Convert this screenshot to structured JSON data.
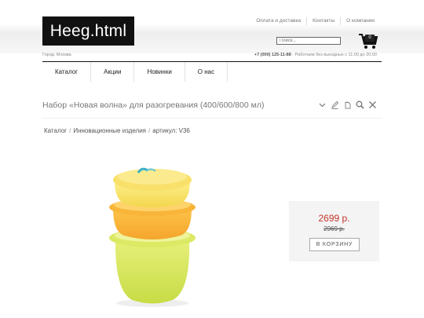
{
  "header": {
    "logo_text": "Heeg.html",
    "top_links": [
      "Оплата и доставка",
      "Контакты",
      "О компании"
    ],
    "search_placeholder": "Поиск...",
    "cart_count": "0",
    "city": "Город: Москва",
    "phone": "+7 (000) 125-11-88",
    "hours": " - Работаем без выходных с 11:00 до 20:00"
  },
  "nav": {
    "items": [
      "Каталог",
      "Акции",
      "Новинки",
      "О нас"
    ]
  },
  "product": {
    "title": "Набор «Новая волна» для разогревания (400/600/800 мл)",
    "breadcrumb": [
      "Каталог",
      "Инновационные изделия",
      "артикул: V36"
    ],
    "price": "2699 р.",
    "old_price": "2969 р.",
    "buy_label": "В КОРЗИНУ"
  },
  "icons": [
    "cart-icon",
    "chevron-down-icon",
    "edit-icon",
    "copy-icon",
    "zoom-icon",
    "close-icon"
  ],
  "colors": {
    "price": "#c2352c",
    "logo_bg": "#111111"
  }
}
